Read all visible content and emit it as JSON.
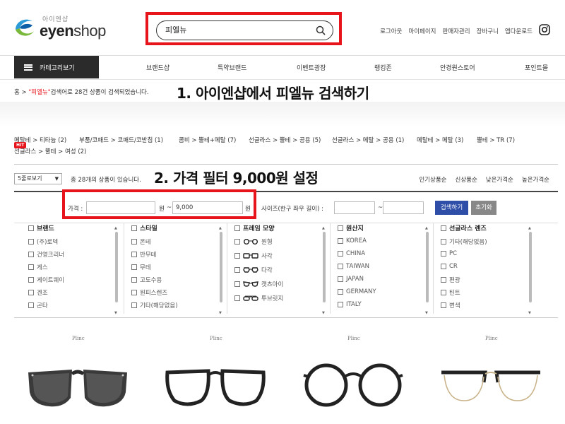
{
  "header": {
    "logo_sub": "아이엔샵",
    "logo_eyen": "eyen",
    "logo_shop": "shop",
    "search_value": "피엘뉴",
    "top_links": [
      "로그아웃",
      "마이페이지",
      "판매자관리",
      "장바구니",
      "앱다운로드"
    ]
  },
  "nav": {
    "category_button": "카테고리보기",
    "items": [
      "브랜드샵",
      "특약브랜드",
      "이벤트광장",
      "랭킹존",
      "안경원스토어",
      "포인트몰"
    ]
  },
  "breadcrumb": {
    "home": "홈",
    "sep": ">",
    "query": "\"피엘뉴\"",
    "result_text": "검색어로 28건 상품이 검색되었습니다."
  },
  "annotations": {
    "step1": "1. 아이엔샵에서 피엘뉴 검색하기",
    "step2": "2. 가격 필터 9,000원 설정"
  },
  "category_tags": {
    "hit_badge": "HIT",
    "row1": [
      "메탈테 > 티타늄 (2)",
      "부품/코패드 > 코패드/코받침 (1)",
      "콤비 > 뿔테+메탈 (7)",
      "선글라스 > 뿔테 > 공용 (5)",
      "선글라스 > 메탈 > 공용 (1)",
      "메탈테 > 메탈 (3)",
      "뿔테 > TR (7)"
    ],
    "row2": [
      "선글라스 > 뿔테 > 여성 (2)"
    ]
  },
  "toolbar": {
    "view_select": "5줄로보기",
    "count_text": "총 28개의 상품이 있습니다.",
    "sorts": [
      "인기상품순",
      "신상품순",
      "낮은가격순",
      "높은가격순"
    ]
  },
  "filter": {
    "price_label": "가격 :",
    "price_min": "",
    "price_max": "9,000",
    "won": "원",
    "tilde": "~",
    "size_label": "사이즈(한구 좌우 길이) :",
    "size_min": "",
    "size_max": "",
    "search_button": "검색하기",
    "reset_button": "초기화",
    "columns": [
      {
        "title": "브랜드",
        "items": [
          "(주)로덱",
          "건영크리너",
          "게스",
          "게이트웨이",
          "겐조",
          "곤타"
        ]
      },
      {
        "title": "스타일",
        "items": [
          "온테",
          "반무테",
          "무테",
          "고도수용",
          "원피스렌즈",
          "기타(해당없음)"
        ]
      },
      {
        "title": "프레임 모양",
        "items": [
          "원형",
          "사각",
          "다각",
          "캣츠아이",
          "투브릿지"
        ]
      },
      {
        "title": "원산지",
        "items": [
          "KOREA",
          "CHINA",
          "TAIWAN",
          "JAPAN",
          "GERMANY",
          "ITALY"
        ]
      },
      {
        "title": "선글라스 렌즈",
        "items": [
          "기타(해당없음)",
          "PC",
          "CR",
          "편광",
          "틴트",
          "변색"
        ]
      }
    ]
  },
  "products": {
    "brand": "Plinc"
  },
  "colors": {
    "highlight": "#e8141b",
    "search_button": "#2f4ea8",
    "nav_dark": "#2b2b2b"
  }
}
